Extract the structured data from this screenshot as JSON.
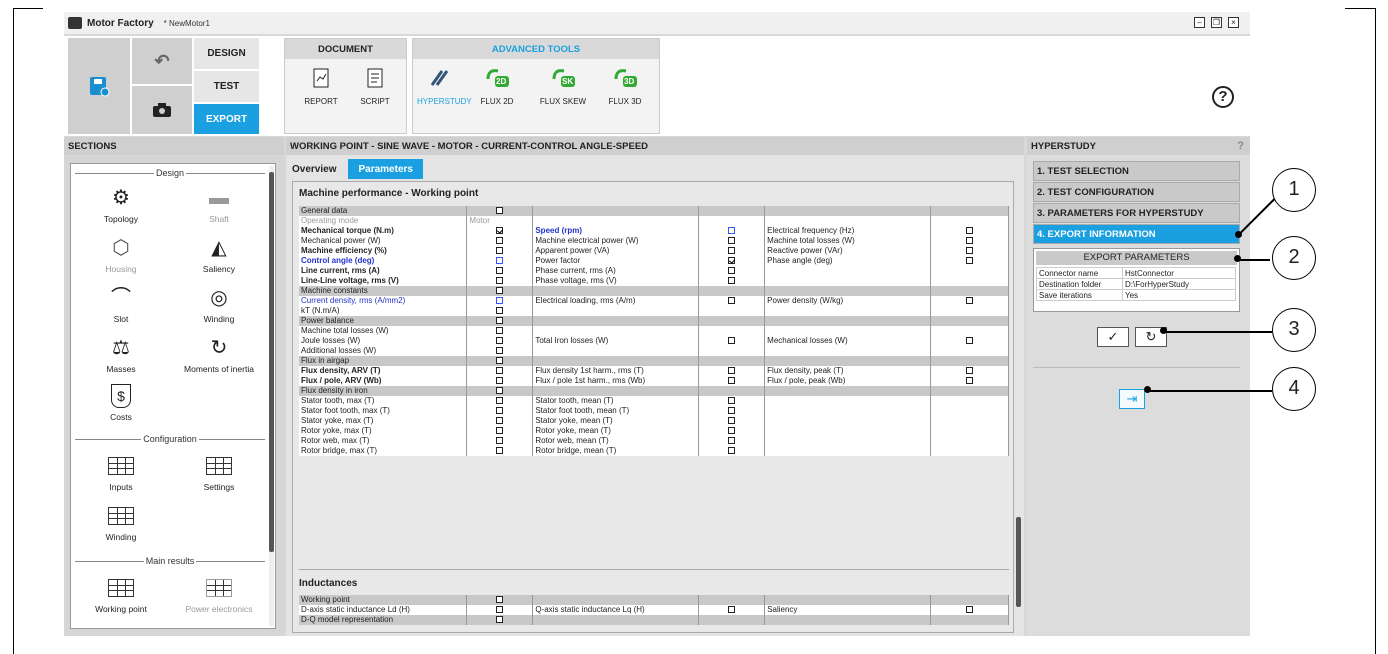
{
  "window": {
    "app_title": "Motor Factory",
    "doc_title": "* NewMotor1"
  },
  "ribbon": {
    "modes": [
      "DESIGN",
      "TEST",
      "EXPORT"
    ],
    "document_group": "DOCUMENT",
    "document_tools": [
      "REPORT",
      "SCRIPT"
    ],
    "advanced_group": "ADVANCED TOOLS",
    "advanced_tools": [
      "HYPERSTUDY",
      "FLUX 2D",
      "FLUX SKEW",
      "FLUX 3D"
    ],
    "advanced_icon_tags": [
      "2D",
      "SK",
      "3D"
    ],
    "help": "?"
  },
  "sections": {
    "title": "SECTIONS",
    "groups": [
      "Design",
      "Configuration",
      "Main results"
    ],
    "design_items": [
      "Topology",
      "Shaft",
      "Housing",
      "Saliency",
      "Slot",
      "Winding",
      "Masses",
      "Moments of inertia",
      "Costs"
    ],
    "config_items": [
      "Inputs",
      "Settings",
      "Winding"
    ],
    "result_items": [
      "Working point",
      "Power electronics"
    ],
    "costs_symbol": "$"
  },
  "main": {
    "title": "WORKING POINT - SINE WAVE - MOTOR - CURRENT-CONTROL ANGLE-SPEED",
    "tabs": [
      "Overview",
      "Parameters"
    ],
    "section1": "Machine performance - Working point",
    "section2": "Inductances",
    "rows": [
      {
        "g": 1,
        "a": "General data"
      },
      {
        "a": "Operating mode",
        "as": "grey",
        "b": "Motor",
        "bs": "grey"
      },
      {
        "a": "Mechanical torque (N.m)",
        "as": "b",
        "ca": "on",
        "c": "Speed (rpm)",
        "cs": "b blue",
        "cc": "blue",
        "e": "Electrical frequency (Hz)",
        "ce": 1
      },
      {
        "a": "Mechanical power (W)",
        "ca": 1,
        "c": "Machine electrical power (W)",
        "cc": 1,
        "e": "Machine total losses (W)",
        "ce": 1
      },
      {
        "a": "Machine efficiency (%)",
        "as": "b",
        "ca": 1,
        "c": "Apparent power (VA)",
        "cc": 1,
        "e": "Reactive power (VAr)",
        "ce": 1
      },
      {
        "a": "Control angle (deg)",
        "as": "b blue",
        "ca": "blue",
        "c": "Power factor",
        "cc": "on",
        "e": "Phase angle (deg)",
        "ce": 1
      },
      {
        "a": "Line current, rms (A)",
        "as": "b",
        "ca": 1,
        "c": "Phase current, rms (A)",
        "cc": 1
      },
      {
        "a": "Line-Line voltage, rms (V)",
        "as": "b",
        "ca": 1,
        "c": "Phase voltage, rms (V)",
        "cc": 1
      },
      {
        "g": 1,
        "a": "Machine constants"
      },
      {
        "a": "Current density, rms (A/mm2)",
        "as": "blue",
        "ca": "blue",
        "c": "Electrical loading, rms (A/m)",
        "cc": 1,
        "e": "Power density (W/kg)",
        "ce": 1
      },
      {
        "a": "kT (N.m/A)",
        "ca": 1
      },
      {
        "g": 1,
        "a": "Power balance"
      },
      {
        "a": "Machine total losses (W)",
        "ca": 1
      },
      {
        "a": "Joule losses (W)",
        "ca": 1,
        "c": "Total Iron losses (W)",
        "cc": 1,
        "e": "Mechanical losses (W)",
        "ce": 1
      },
      {
        "a": "Additional losses (W)",
        "ca": 1
      },
      {
        "g": 1,
        "a": "Flux in airgap"
      },
      {
        "a": "Flux density, ARV (T)",
        "as": "b",
        "ca": 1,
        "c": "Flux density 1st harm., rms (T)",
        "cc": 1,
        "e": "Flux density, peak (T)",
        "ce": 1
      },
      {
        "a": "Flux / pole, ARV (Wb)",
        "as": "b",
        "ca": 1,
        "c": "Flux / pole 1st harm., rms (Wb)",
        "cc": 1,
        "e": "Flux / pole, peak (Wb)",
        "ce": 1
      },
      {
        "g": 1,
        "a": "Flux density in iron"
      },
      {
        "a": "Stator tooth, max (T)",
        "ca": 1,
        "c": "Stator tooth, mean (T)",
        "cc": 1
      },
      {
        "a": "Stator foot tooth, max (T)",
        "ca": 1,
        "c": "Stator foot tooth, mean (T)",
        "cc": 1
      },
      {
        "a": "Stator yoke, max (T)",
        "ca": 1,
        "c": "Stator yoke, mean (T)",
        "cc": 1
      },
      {
        "a": "Rotor yoke, max (T)",
        "ca": 1,
        "c": "Rotor yoke, mean (T)",
        "cc": 1
      },
      {
        "a": "Rotor web, max (T)",
        "ca": 1,
        "c": "Rotor web, mean (T)",
        "cc": 1
      },
      {
        "a": "Rotor bridge, max (T)",
        "ca": 1,
        "c": "Rotor bridge, mean (T)",
        "cc": 1
      }
    ],
    "rows2": [
      {
        "g": 1,
        "a": "Working point"
      },
      {
        "a": "D-axis static inductance Ld (H)",
        "ca": 1,
        "c": "Q-axis static inductance Lq (H)",
        "cc": 1,
        "e": "Saliency",
        "ce": 1
      },
      {
        "g": 1,
        "a": "D-Q model representation"
      }
    ]
  },
  "hyperstudy": {
    "title": "HYPERSTUDY",
    "help": "?",
    "steps": [
      "1. TEST SELECTION",
      "2. TEST CONFIGURATION",
      "3. PARAMETERS FOR HYPERSTUDY",
      "4. EXPORT INFORMATION"
    ],
    "export_title": "EXPORT PARAMETERS",
    "params": [
      [
        "Connector name",
        "HstConnector"
      ],
      [
        "Destination folder",
        "D:\\ForHyperStudy"
      ],
      [
        "Save iterations",
        "Yes"
      ]
    ],
    "ok_symbol": "✓",
    "reset_symbol": "↻",
    "export_symbol": "⇥"
  },
  "callouts": [
    "1",
    "2",
    "3",
    "4"
  ]
}
